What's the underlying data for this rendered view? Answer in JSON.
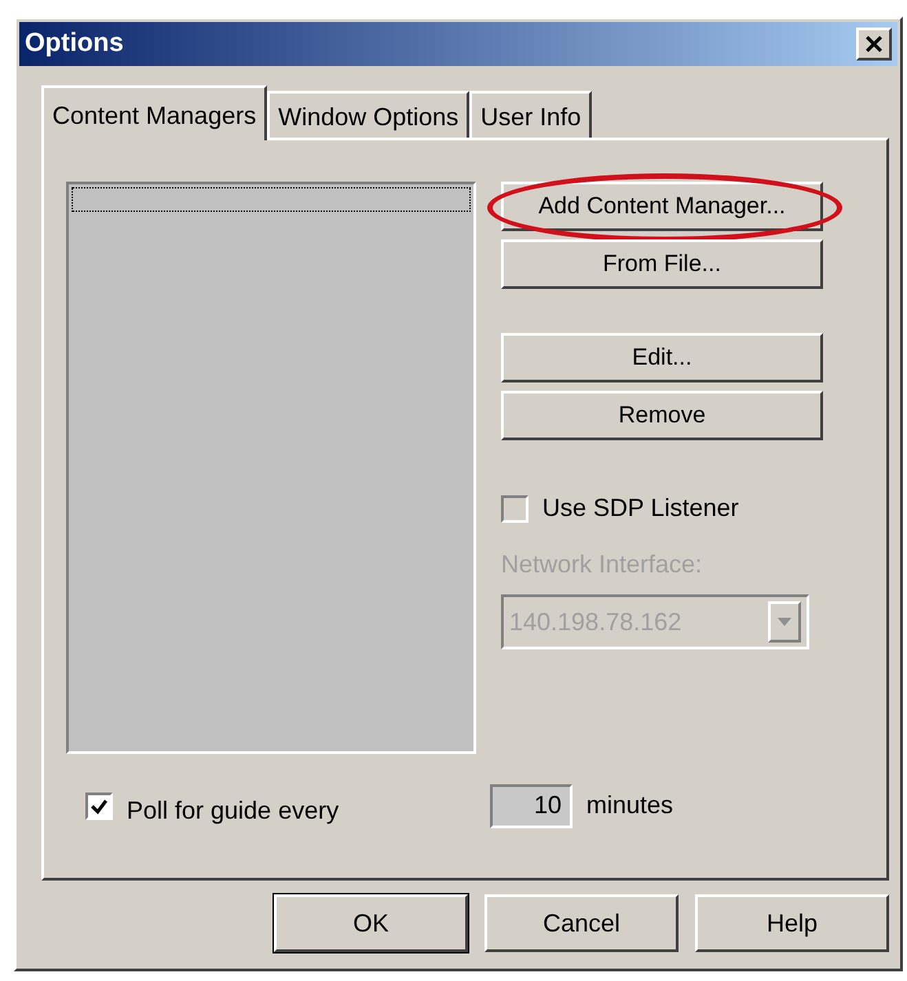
{
  "window": {
    "title": "Options"
  },
  "tabs": [
    {
      "label": "Content Managers",
      "selected": true
    },
    {
      "label": "Window Options",
      "selected": false
    },
    {
      "label": "User Info",
      "selected": false
    }
  ],
  "content_managers": {
    "items": [
      {
        "focused": true
      }
    ]
  },
  "side_button_groups": [
    {
      "buttons": [
        {
          "label": "Add Content Manager...",
          "highlighted": true
        },
        {
          "label": "From File...",
          "highlighted": false
        }
      ]
    },
    {
      "buttons": [
        {
          "label": "Edit...",
          "highlighted": false
        },
        {
          "label": "Remove",
          "highlighted": false
        }
      ]
    }
  ],
  "sdp_listener": {
    "label": "Use SDP Listener",
    "checked": false,
    "disabled": true
  },
  "network_interface": {
    "label": "Network Interface:",
    "value": "140.198.78.162",
    "disabled": true
  },
  "poll": {
    "label": "Poll for guide every",
    "checked": true,
    "value": "10",
    "unit": "minutes"
  },
  "buttons": [
    {
      "label": "OK",
      "default": true
    },
    {
      "label": "Cancel",
      "default": false
    },
    {
      "label": "Help",
      "default": false
    }
  ]
}
